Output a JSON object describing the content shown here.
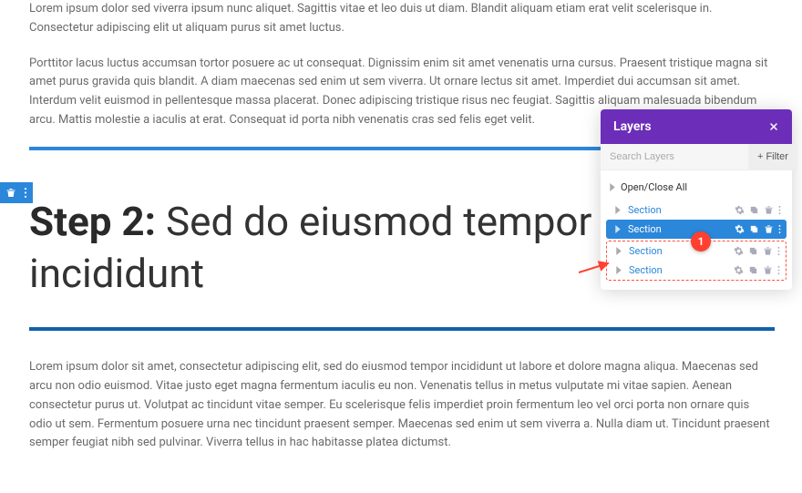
{
  "paragraphs": {
    "p1": "Lorem ipsum dolor sed viverra ipsum nunc aliquet. Sagittis vitae et leo duis ut diam. Blandit aliquam etiam erat velit scelerisque in. Consectetur adipiscing elit ut aliquam purus sit amet luctus.",
    "p2": "Porttitor lacus luctus accumsan tortor posuere ac ut consequat. Dignissim enim sit amet venenatis urna cursus. Praesent tristique magna sit amet purus gravida quis blandit. A diam maecenas sed enim ut sem viverra. Ut ornare lectus sit amet. Imperdiet dui accumsan sit amet. Interdum velit euismod in pellentesque massa placerat. Donec adipiscing tristique risus nec feugiat. Sagittis aliquam malesuada bibendum arcu. Mattis molestie a iaculis at erat. Consequat id porta nibh venenatis cras sed felis eget velit.",
    "p3": "Lorem ipsum dolor sit amet, consectetur adipiscing elit, sed do eiusmod tempor incididunt ut labore et dolore magna aliqua. Maecenas sed arcu non odio euismod. Vitae justo eget magna fermentum iaculis eu non. Venenatis tellus in metus vulputate mi vitae sapien. Aenean consectetur purus ut. Volutpat ac tincidunt vitae semper. Eu scelerisque felis imperdiet proin fermentum leo vel orci porta non ornare quis odio ut sem. Fermentum posuere urna nec tincidunt praesent semper. Maecenas sed enim ut sem viverra a. Nulla diam ut. Tincidunt praesent semper feugiat nibh sed pulvinar. Viverra tellus in hac habitasse platea dictumst."
  },
  "heading": {
    "bold": "Step 2:",
    "rest": " Sed do eiusmod tempor incididunt"
  },
  "layersPanel": {
    "title": "Layers",
    "searchPlaceholder": "Search Layers",
    "filterLabel": "Filter",
    "openCloseLabel": "Open/Close All",
    "items": [
      {
        "label": "Section"
      },
      {
        "label": "Section"
      },
      {
        "label": "Section"
      },
      {
        "label": "Section"
      }
    ]
  },
  "callout": "1",
  "colors": {
    "accent": "#2b87da",
    "purple": "#6c2eb9",
    "danger": "#ff4030"
  }
}
